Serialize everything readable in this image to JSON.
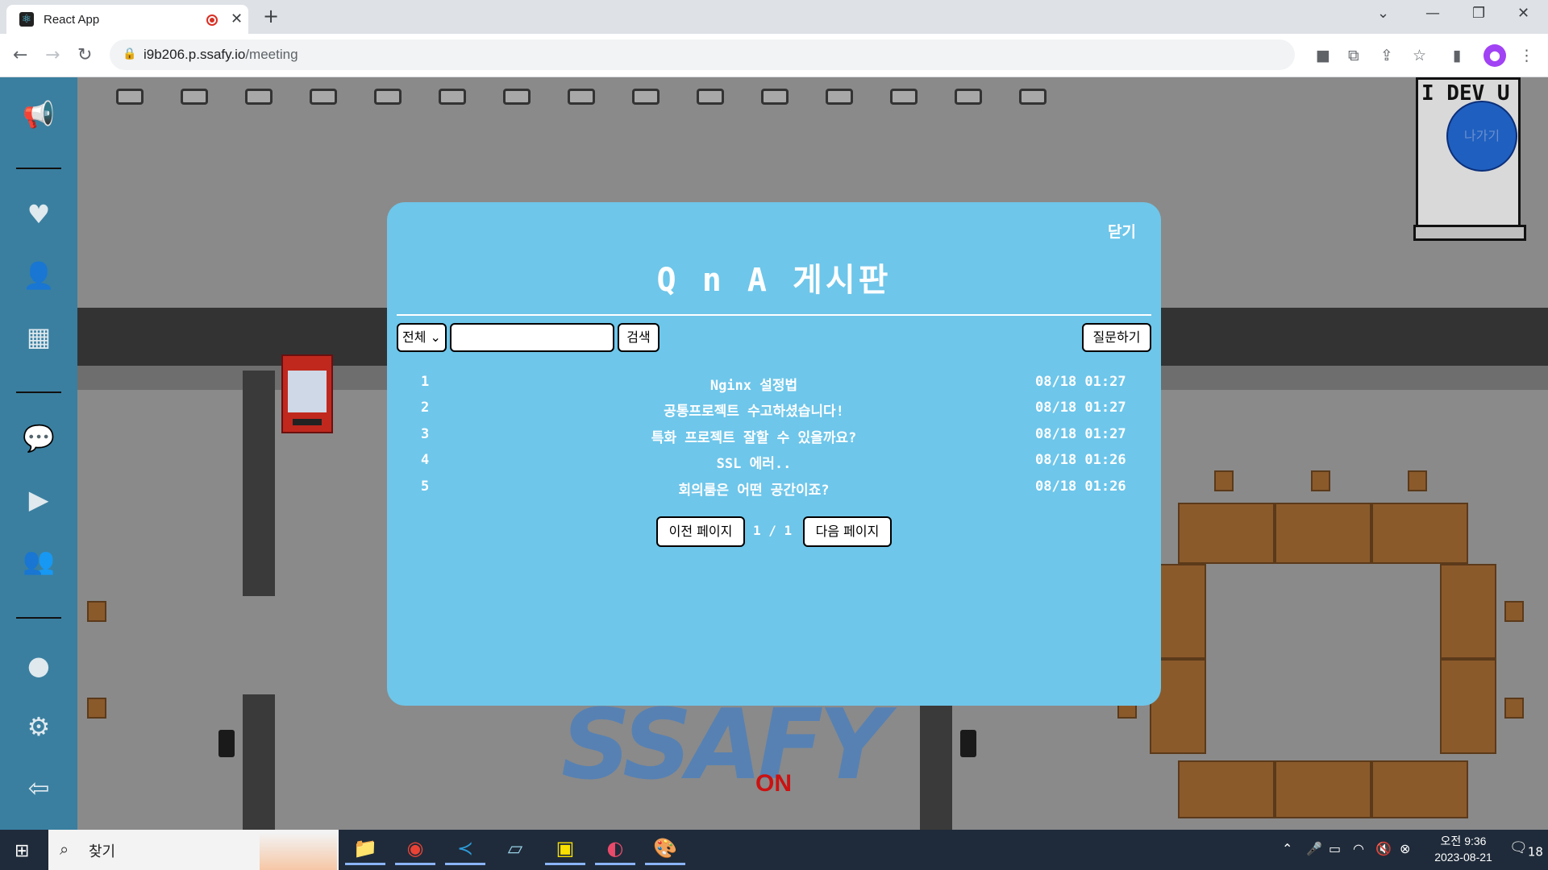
{
  "browser": {
    "tab_title": "React App",
    "url_host": "i9b206.p.ssafy.io",
    "url_path": "/meeting"
  },
  "game": {
    "sign_text": "I DEV U",
    "exit_button_label": "나가기",
    "on_label": "ON"
  },
  "modal": {
    "close_label": "닫기",
    "title": "Q n A 게시판",
    "filter_selected": "전체",
    "search_value": "",
    "search_button_label": "검색",
    "ask_button_label": "질문하기",
    "questions": [
      {
        "num": "1",
        "title": "Nginx 설정법",
        "date": "08/18 01:27"
      },
      {
        "num": "2",
        "title": "공통프로젝트 수고하셨습니다!",
        "date": "08/18 01:27"
      },
      {
        "num": "3",
        "title": "특화 프로젝트 잘할 수 있을까요?",
        "date": "08/18 01:27"
      },
      {
        "num": "4",
        "title": "SSL 에러..",
        "date": "08/18 01:26"
      },
      {
        "num": "5",
        "title": "회의룸은 어떤 공간이죠?",
        "date": "08/18 01:26"
      }
    ],
    "prev_button_label": "이전 페이지",
    "page_indicator": "1 / 1",
    "next_button_label": "다음 페이지"
  },
  "taskbar": {
    "search_label": "찾기",
    "time": "오전 9:36",
    "date": "2023-08-21",
    "notification_count": "18"
  }
}
